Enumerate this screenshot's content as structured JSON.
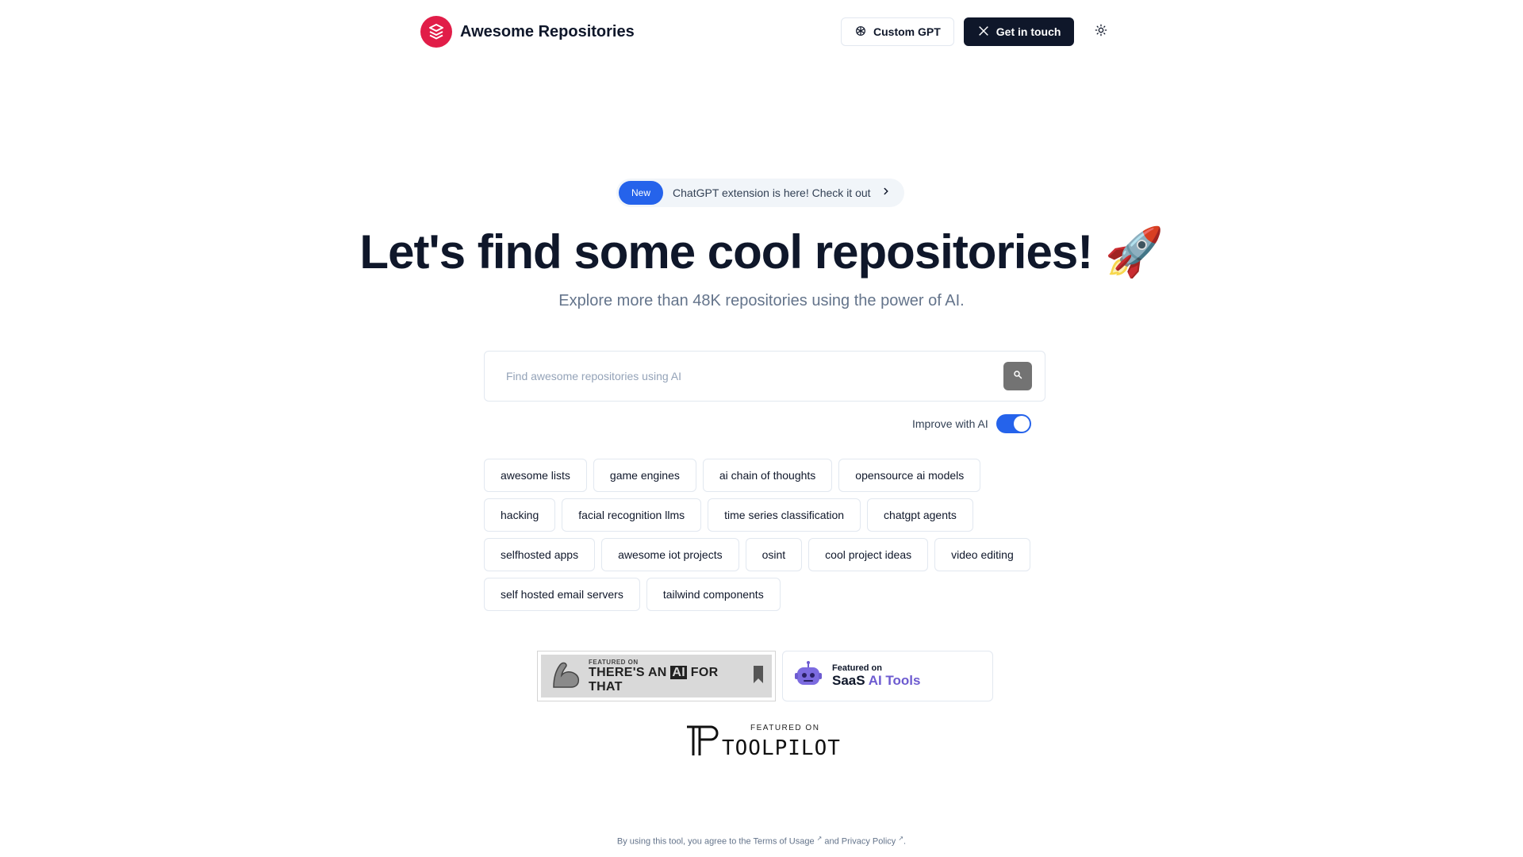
{
  "brand": {
    "name": "Awesome Repositories",
    "color": "#e11d48"
  },
  "nav": {
    "custom_gpt": "Custom GPT",
    "get_in_touch": "Get in touch"
  },
  "announcement": {
    "badge": "New",
    "text": "ChatGPT extension is here! Check it out"
  },
  "hero": {
    "title": "Let's find some cool repositories! 🚀",
    "subtitle": "Explore more than 48K repositories using the power of AI."
  },
  "search": {
    "placeholder": "Find awesome repositories using AI",
    "value": ""
  },
  "improve": {
    "label": "Improve with AI",
    "enabled": true,
    "accent": "#2563eb"
  },
  "tags": [
    "awesome lists",
    "game engines",
    "ai chain of thoughts",
    "opensource ai models",
    "hacking",
    "facial recognition llms",
    "time series classification",
    "chatgpt agents",
    "selfhosted apps",
    "awesome iot projects",
    "osint",
    "cool project ideas",
    "video editing",
    "self hosted email servers",
    "tailwind components"
  ],
  "badges": {
    "aift": {
      "small": "FEATURED ON",
      "pre": "THERE'S AN ",
      "ai": "AI",
      "post": " FOR THAT"
    },
    "saas": {
      "small": "Featured on",
      "pre": "SaaS ",
      "accent": "AI Tools"
    },
    "toolpilot": {
      "small": "FEATURED ON",
      "name": "TOOLPILOT"
    }
  },
  "footer": {
    "pre": "By using this tool, you agree to the ",
    "terms": "Terms of Usage",
    "mid": " and ",
    "privacy": "Privacy Policy",
    "post": "."
  }
}
